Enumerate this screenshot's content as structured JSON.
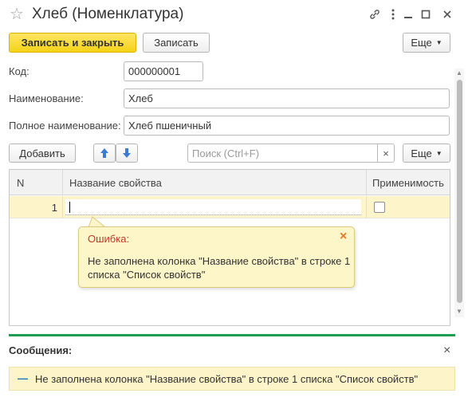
{
  "window": {
    "title": "Хлеб (Номенклатура)",
    "icons": [
      "star-icon",
      "link-icon",
      "more-icon",
      "minimize-icon",
      "maximize-icon",
      "close-icon"
    ]
  },
  "toolbar": {
    "save_close_label": "Записать и закрыть",
    "save_label": "Записать",
    "more_label": "Еще"
  },
  "form": {
    "code_label": "Код:",
    "code_value": "000000001",
    "name_label": "Наименование:",
    "name_value": "Хлеб",
    "fullname_label": "Полное наименование:",
    "fullname_value": "Хлеб пшеничный"
  },
  "table_toolbar": {
    "add_label": "Добавить",
    "search_placeholder": "Поиск (Ctrl+F)",
    "clear_symbol": "×",
    "more_label": "Еще"
  },
  "table": {
    "columns": [
      "N",
      "Название свойства",
      "Применимость"
    ],
    "rows": [
      {
        "n": "1",
        "name": "",
        "applicable": false
      }
    ]
  },
  "error_tooltip": {
    "title": "Ошибка:",
    "text_line1": "Не заполнена колонка \"Название свойства\" в строке 1",
    "text_line2": "списка \"Список свойств\"",
    "close_symbol": "×"
  },
  "messages": {
    "title": "Сообщения:",
    "close_symbol": "×",
    "items": [
      {
        "bullet": "—",
        "text": "Не заполнена колонка \"Название свойства\" в строке 1 списка \"Список свойств\""
      }
    ]
  },
  "colors": {
    "primary_button": "#f5d317",
    "row_highlight": "#fdf4c9",
    "error_title": "#c0392b",
    "arrow_blue": "#3a7bd5",
    "messages_accent": "#1e9d55",
    "close_red": "#e07a2a"
  }
}
